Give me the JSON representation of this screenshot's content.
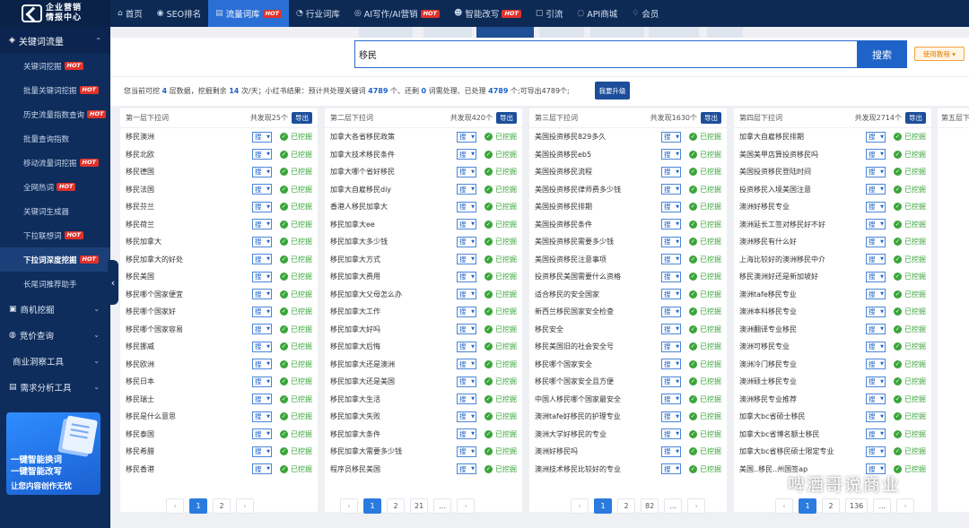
{
  "brand": {
    "line1": "企业营销",
    "line2": "情报中心"
  },
  "topnav": [
    {
      "icon": "⌂",
      "label": "首页",
      "hot": ""
    },
    {
      "icon": "◉",
      "label": "SEO排名",
      "hot": ""
    },
    {
      "icon": "▤",
      "label": "流量词库",
      "hot": "HOT",
      "active": true
    },
    {
      "icon": "◔",
      "label": "行业词库",
      "hot": ""
    },
    {
      "icon": "◎",
      "label": "AI写作/AI营销",
      "hot": "HOT"
    },
    {
      "icon": "☻",
      "label": "智能改写",
      "hot": "HOT"
    },
    {
      "icon": "▢",
      "label": "引流",
      "hot": ""
    },
    {
      "icon": "◌",
      "label": "API商城",
      "hot": ""
    },
    {
      "icon": "♢",
      "label": "会员",
      "hot": ""
    }
  ],
  "sidebar": {
    "head": {
      "icon": "◈",
      "label": "关键词流量"
    },
    "items": [
      {
        "label": "关键词挖掘",
        "hot": "HOT"
      },
      {
        "label": "批量关键词挖掘",
        "hot": "HOT"
      },
      {
        "label": "历史流量指数查询",
        "hot": "HOT"
      },
      {
        "label": "批量查询指数",
        "hot": ""
      },
      {
        "label": "移动流量词挖掘",
        "hot": "HOT"
      },
      {
        "label": "全网热词",
        "hot": "HOT"
      },
      {
        "label": "关键词生成器",
        "hot": ""
      },
      {
        "label": "下拉联想词",
        "hot": "HOT"
      },
      {
        "label": "下拉词深度挖掘",
        "hot": "HOT",
        "active": true
      },
      {
        "label": "长尾词推荐助手",
        "hot": ""
      }
    ],
    "groups": [
      {
        "icon": "▣",
        "label": "商机挖掘"
      },
      {
        "icon": "◍",
        "label": "竞价查询"
      },
      {
        "icon": "",
        "label": "商业洞察工具"
      },
      {
        "icon": "▤",
        "label": "需求分析工具"
      }
    ],
    "promo": {
      "line1": "一键智能换词",
      "line2": "一键智能改写",
      "line3": "让您内容创作无忧"
    }
  },
  "search": {
    "value": "移民",
    "button": "搜索",
    "tutorial": "使用教程 ▾"
  },
  "info": {
    "p1": "您当前可挖 ",
    "depth": "4",
    "p2": " 层数据，挖掘剩余 ",
    "remain": "14",
    "p3": " 次/天；小红书结果：预计共处理关键词 ",
    "total": "4789",
    "p4": " 个、还剩 ",
    "left": "0",
    "p5": " 词需处理、已处理 ",
    "done": "4789",
    "p6": " 个;可导出4789个;",
    "upgrade": "我要升级"
  },
  "search_opt": "搜",
  "status_text": "已挖掘",
  "export_label": "导出",
  "columns": [
    {
      "title": "第一层下拉词",
      "count": "共发现25个",
      "rows": [
        "移民澳洲",
        "移民北欧",
        "移民德国",
        "移民法国",
        "移民芬兰",
        "移民荷兰",
        "移民加拿大",
        "移民加拿大的好处",
        "移民美国",
        "移民哪个国家便宜",
        "移民哪个国家好",
        "移民哪个国家容易",
        "移民挪威",
        "移民欧洲",
        "移民日本",
        "移民瑞士",
        "移民是什么意思",
        "移民泰国",
        "移民希腊",
        "移民香港"
      ],
      "pages": [
        "1",
        "2"
      ]
    },
    {
      "title": "第二层下拉词",
      "count": "共发现420个",
      "rows": [
        "加拿大各省移民政策",
        "加拿大技术移民条件",
        "加拿大哪个省好移民",
        "加拿大自雇移民diy",
        "香港人移民加拿大",
        "移民加拿大ee",
        "移民加拿大多少钱",
        "移民加拿大方式",
        "移民加拿大费用",
        "移民加拿大父母怎么办",
        "移民加拿大工作",
        "移民加拿大好吗",
        "移民加拿大后悔",
        "移民加拿大还是澳洲",
        "移民加拿大还是美国",
        "移民加拿大生活",
        "移民加拿大失败",
        "移民加拿大条件",
        "移民加拿大需要多少钱",
        "程序员移民美国"
      ],
      "pages": [
        "1",
        "2",
        "21",
        "..."
      ]
    },
    {
      "title": "第三层下拉词",
      "count": "共发现1630个",
      "rows": [
        "美国投资移民829多久",
        "美国投资移民eb5",
        "美国投资移民流程",
        "美国投资移民律师费多少钱",
        "美国投资移民排期",
        "美国投资移民条件",
        "美国投资移民需要多少钱",
        "美国投资移民注意事项",
        "投资移民美国需要什么资格",
        "适合移民的安全国家",
        "新西兰移民国家安全检查",
        "移民安全",
        "移民美国旧的社会安全号",
        "移民哪个国家安全",
        "移民哪个国家安全且方便",
        "中国人移民哪个国家最安全",
        "澳洲tafe好移民的护理专业",
        "澳洲大学好移民的专业",
        "澳洲好移民吗",
        "澳洲技术移民比较好的专业"
      ],
      "pages": [
        "1",
        "2",
        "82",
        "..."
      ]
    },
    {
      "title": "第四层下拉词",
      "count": "共发现2714个",
      "rows": [
        "加拿大自雇移民排期",
        "美国美甲店算投资移民吗",
        "美国投资移民登陆时间",
        "投资移民入境美国注意",
        "澳洲好移民专业",
        "澳洲延长工签对移民好不好",
        "澳洲移民有什么好",
        "上海比较好的澳洲移民中介",
        "移民澳洲好还是新加坡好",
        "澳洲tafe移民专业",
        "澳洲本科移民专业",
        "澳洲翻译专业移民",
        "澳洲可移民专业",
        "澳洲冷门移民专业",
        "澳洲硕士移民专业",
        "澳洲移民专业推荐",
        "加拿大bc省硕士移民",
        "加拿大bc省博名额士移民",
        "加拿大bc省移民硕士限定专业",
        "美国..移民..州国签ap"
      ],
      "pages": [
        "1",
        "2",
        "136",
        "..."
      ]
    }
  ],
  "column5_title": "第五层下拉词",
  "watermark": "啤酒哥说商业"
}
